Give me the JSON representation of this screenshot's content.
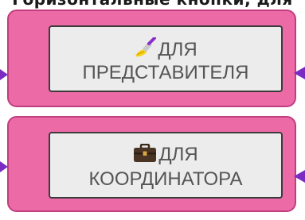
{
  "header": {
    "partial_text": "Горизонтальные кнопки, для"
  },
  "buttons": [
    {
      "icon": "paintbrush-icon",
      "line1": "ДЛЯ",
      "line2": "ПРЕДСТАВИТЕЛЯ"
    },
    {
      "icon": "briefcase-icon",
      "line1": "ДЛЯ",
      "line2": "КООРДИНАТОРА"
    }
  ],
  "colors": {
    "card_fill": "#ec6aa6",
    "card_border": "#c13e7e",
    "button_fill": "#ececec",
    "button_border": "#3c3c3c",
    "button_text": "#555555",
    "connector_arrow": "#7a2bc2"
  }
}
